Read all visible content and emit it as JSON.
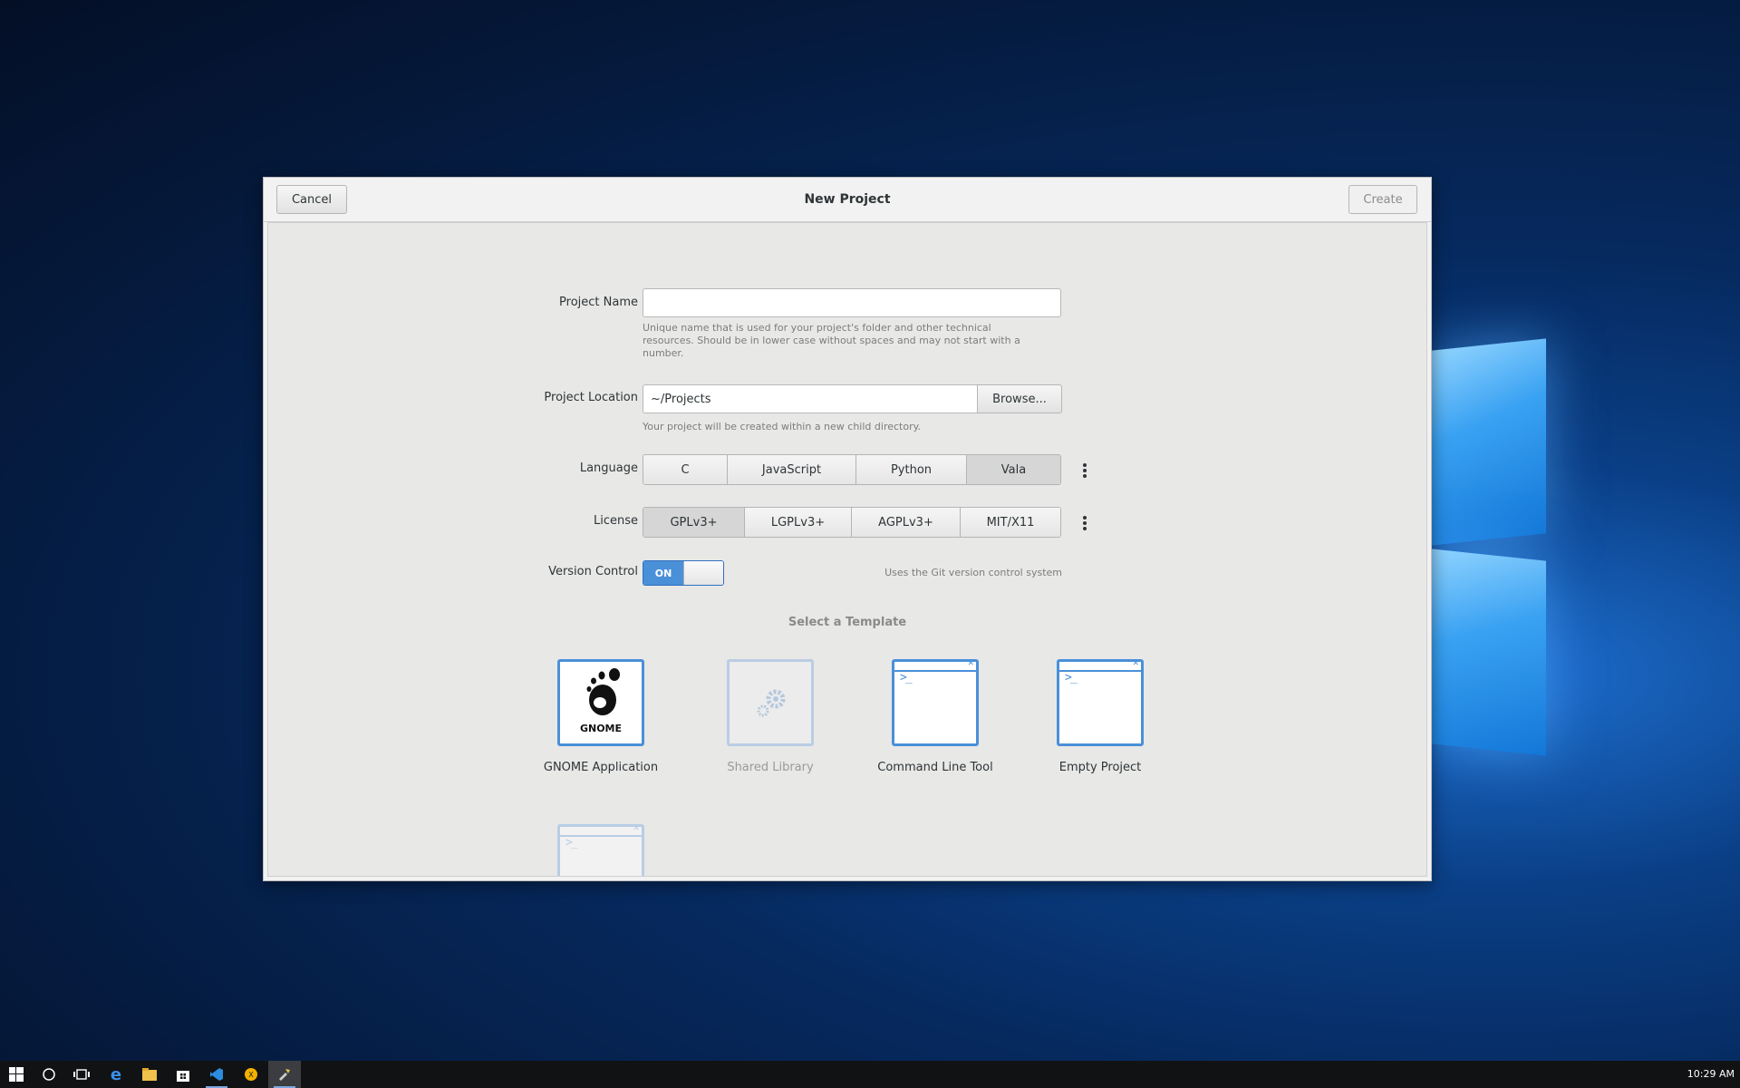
{
  "dialog": {
    "title": "New Project",
    "cancel_label": "Cancel",
    "create_label": "Create"
  },
  "form": {
    "project_name": {
      "label": "Project Name",
      "value": "",
      "hint": "Unique name that is used for your project's folder and other technical resources. Should be in lower case without spaces and may not start with a number."
    },
    "project_location": {
      "label": "Project Location",
      "value": "~/Projects",
      "browse_label": "Browse...",
      "hint": "Your project will be created within a new child directory."
    },
    "language": {
      "label": "Language",
      "options": [
        "C",
        "JavaScript",
        "Python",
        "Vala"
      ],
      "selected": "Vala"
    },
    "license": {
      "label": "License",
      "options": [
        "GPLv3+",
        "LGPLv3+",
        "AGPLv3+",
        "MIT/X11"
      ],
      "selected": "GPLv3+"
    },
    "version_control": {
      "label": "Version Control",
      "state": "ON",
      "hint": "Uses the Git version control system"
    }
  },
  "templates": {
    "heading": "Select a Template",
    "items": [
      {
        "label": "GNOME Application",
        "icon": "gnome-foot-icon",
        "enabled": true
      },
      {
        "label": "Shared Library",
        "icon": "gears-icon",
        "enabled": false
      },
      {
        "label": "Command Line Tool",
        "icon": "terminal-icon",
        "enabled": true
      },
      {
        "label": "Empty Project",
        "icon": "terminal-icon",
        "enabled": true
      },
      {
        "label": "",
        "icon": "terminal-icon",
        "enabled": false
      }
    ],
    "gnome_logo_text": "GNOME"
  },
  "taskbar": {
    "icons": [
      "windows-start-icon",
      "cortana-icon",
      "task-view-icon",
      "edge-icon",
      "file-explorer-icon",
      "store-icon",
      "vscode-icon",
      "app-icon",
      "builder-icon"
    ],
    "clock": "10:29 AM"
  },
  "colors": {
    "accent": "#4a90d9",
    "dialog_bg": "#f2f2f2",
    "content_bg": "#e8e8e7",
    "taskbar_bg": "#111214"
  }
}
